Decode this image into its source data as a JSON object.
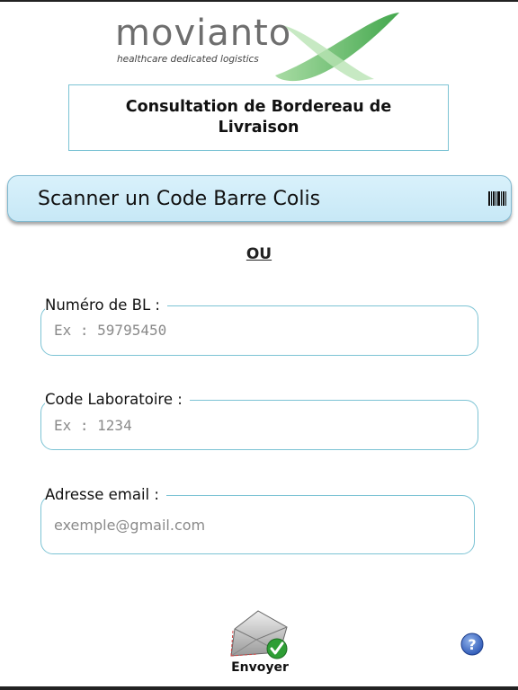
{
  "brand": {
    "name": "movianto",
    "tagline": "healthcare dedicated logistics",
    "accent": "#3aa83a"
  },
  "title": "Consultation de Bordereau de Livraison",
  "scan": {
    "label": "Scanner un Code Barre Colis",
    "icon": "barcode-icon"
  },
  "separator": "OU",
  "fields": {
    "bl": {
      "label": "Numéro de BL :",
      "placeholder": "Ex : 59795450",
      "value": ""
    },
    "lab": {
      "label": "Code Laboratoire :",
      "placeholder": "Ex : 1234",
      "value": ""
    },
    "email": {
      "label": "Adresse email :",
      "placeholder": "exemple@gmail.com",
      "value": ""
    }
  },
  "send": {
    "label": "Envoyer",
    "icon": "envelope-check-icon"
  },
  "help": {
    "icon": "help-icon"
  },
  "colors": {
    "border": "#7cc3d4",
    "scan_bg": "#cdebf7",
    "text": "#111111"
  }
}
